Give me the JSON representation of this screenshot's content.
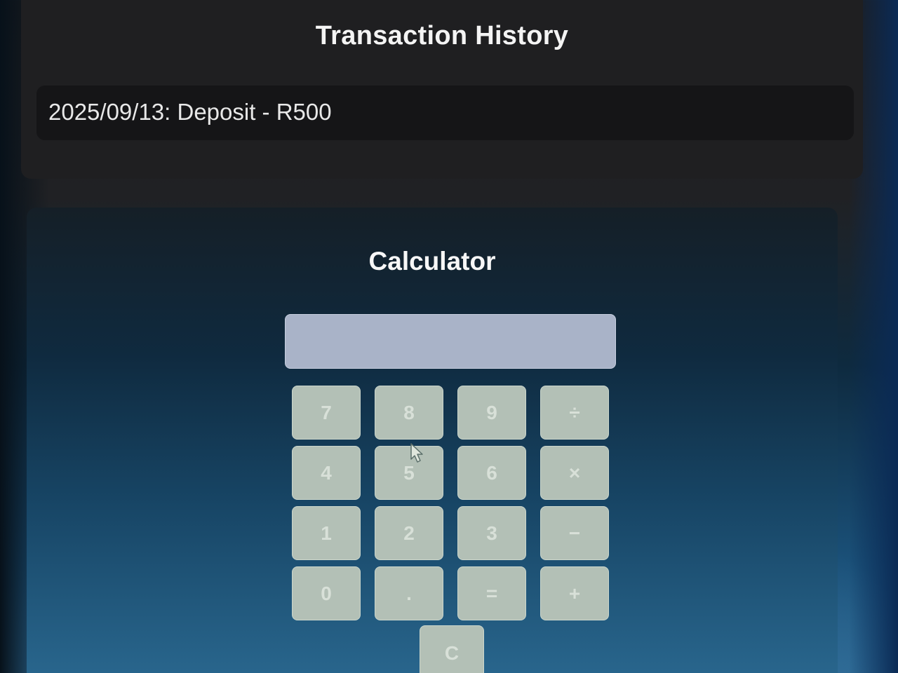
{
  "history": {
    "title": "Transaction History",
    "items": [
      {
        "text": "2025/09/13: Deposit - R500"
      }
    ]
  },
  "calculator": {
    "title": "Calculator",
    "display_value": "",
    "keys": [
      {
        "label": "7",
        "name": "key-7"
      },
      {
        "label": "8",
        "name": "key-8"
      },
      {
        "label": "9",
        "name": "key-9"
      },
      {
        "label": "÷",
        "name": "key-divide"
      },
      {
        "label": "4",
        "name": "key-4"
      },
      {
        "label": "5",
        "name": "key-5"
      },
      {
        "label": "6",
        "name": "key-6"
      },
      {
        "label": "×",
        "name": "key-multiply"
      },
      {
        "label": "1",
        "name": "key-1"
      },
      {
        "label": "2",
        "name": "key-2"
      },
      {
        "label": "3",
        "name": "key-3"
      },
      {
        "label": "−",
        "name": "key-subtract"
      },
      {
        "label": "0",
        "name": "key-0"
      },
      {
        "label": ".",
        "name": "key-decimal"
      },
      {
        "label": "=",
        "name": "key-equals"
      },
      {
        "label": "+",
        "name": "key-add"
      }
    ],
    "clear_label": "C"
  },
  "icons": {
    "cursor": "mouse-pointer-icon"
  },
  "colors": {
    "display": "#a9b3c8",
    "key": "#b3c0b6",
    "history_panel": "#1f1f21"
  }
}
